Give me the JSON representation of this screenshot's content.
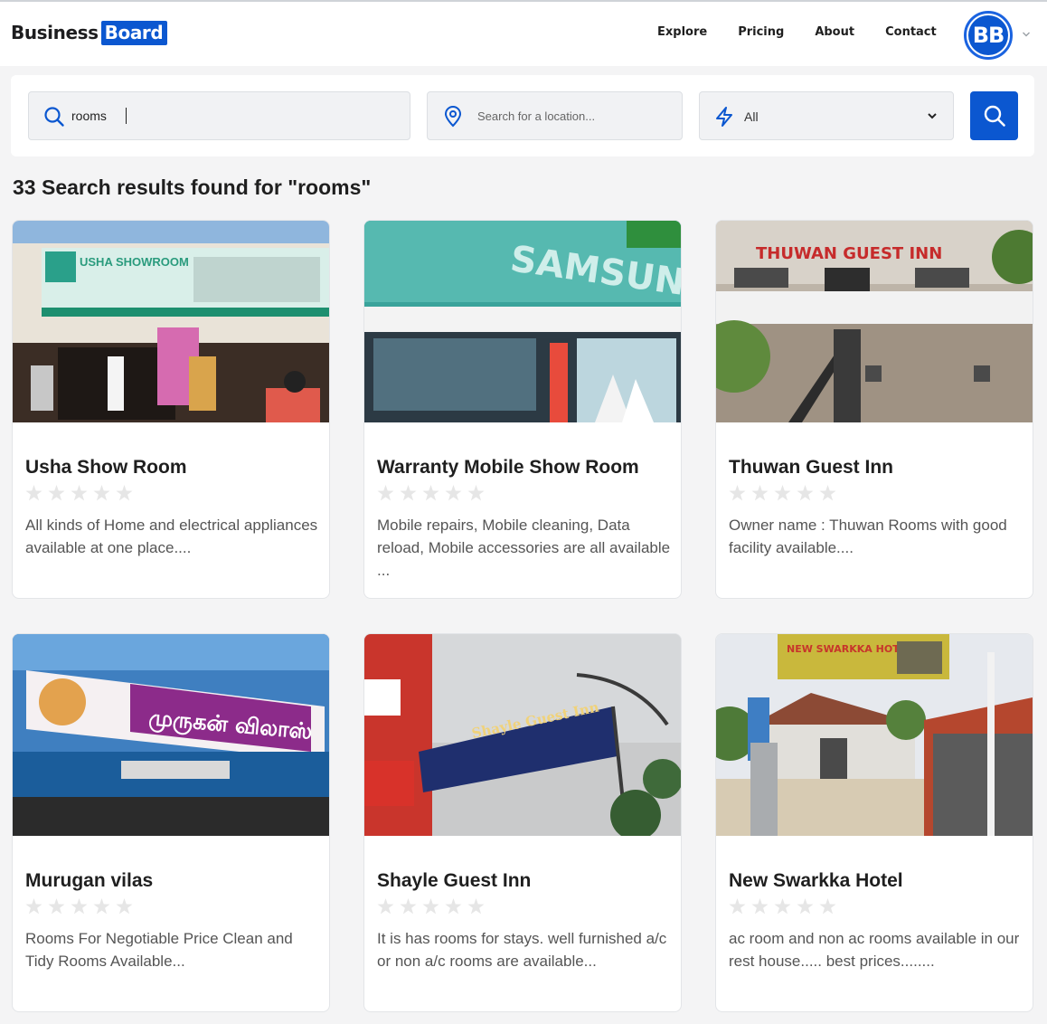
{
  "brand": {
    "part1": "Business",
    "part2": "Board"
  },
  "nav": {
    "items": [
      "Explore",
      "Pricing",
      "About",
      "Contact"
    ]
  },
  "user": {
    "initials": "BB"
  },
  "search": {
    "query_value": "rooms",
    "location_placeholder": "Search for a location...",
    "category_value": "All"
  },
  "results_heading": "33 Search results found for \"rooms\"",
  "listings": [
    {
      "title": "Usha Show Room",
      "description": "All kinds of Home and electrical appliances available at one place....",
      "rating": 0
    },
    {
      "title": "Warranty Mobile Show Room",
      "description": "Mobile repairs, Mobile cleaning, Data reload, Mobile accessories are all available ...",
      "rating": 0
    },
    {
      "title": "Thuwan Guest Inn",
      "description": "Owner name : Thuwan Rooms with good facility available....",
      "rating": 0
    },
    {
      "title": "Murugan vilas",
      "description": "Rooms For Negotiable Price Clean and Tidy Rooms Available...",
      "rating": 0
    },
    {
      "title": "Shayle Guest Inn",
      "description": "It is has rooms for stays. well furnished a/c or non a/c rooms are available...",
      "rating": 0
    },
    {
      "title": "New Swarkka Hotel",
      "description": "ac room and non ac rooms available in our rest house..... best prices........",
      "rating": 0
    }
  ],
  "photo_signs": {
    "usha": "USHA SHOWROOM",
    "samsung": "SAMSUNG",
    "thuwan": "THUWAN GUEST INN",
    "murugan": "முருகன் விலாஸ்",
    "shayle": "Shayle Guest Inn",
    "swarkka": "NEW SWARKKA HOTEL"
  },
  "colors": {
    "brand_blue": "#0b57d0",
    "star_empty": "#e6e6e6"
  },
  "icons": {
    "search": "search-icon",
    "location": "map-pin-icon",
    "category": "lightning-icon",
    "dropdown": "chevron-down-icon",
    "rating": "star-icon"
  }
}
